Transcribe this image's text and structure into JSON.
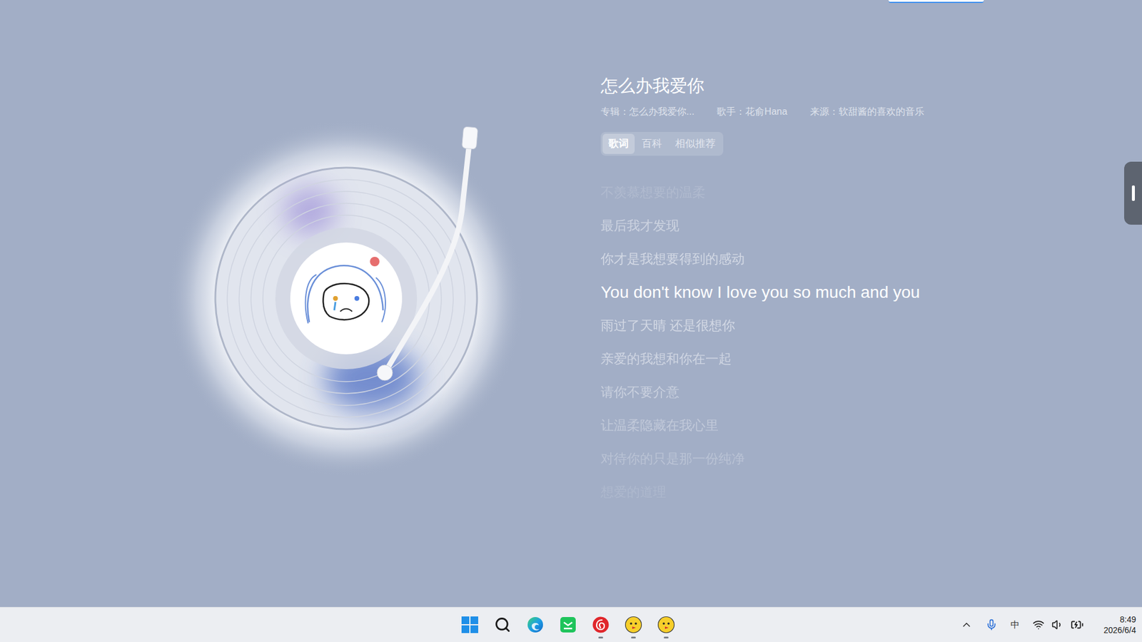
{
  "song": {
    "title": "怎么办我爱你",
    "meta": [
      "专辑：怎么办我爱你...",
      "歌手：花俞Hana",
      "来源：软甜酱的喜欢的音乐"
    ]
  },
  "tabs": [
    {
      "label": "歌词",
      "selected": true
    },
    {
      "label": "百科",
      "selected": false
    },
    {
      "label": "相似推荐",
      "selected": false
    }
  ],
  "lyrics": [
    {
      "text": "不羡慕想要的温柔",
      "current": false
    },
    {
      "text": "最后我才发现",
      "current": false
    },
    {
      "text": "你才是我想要得到的感动",
      "current": false
    },
    {
      "text": "You don't know I love you so much and you",
      "current": true
    },
    {
      "text": "雨过了天晴 还是很想你",
      "current": false
    },
    {
      "text": "亲爱的我想和你在一起",
      "current": false
    },
    {
      "text": "请你不要介意",
      "current": false
    },
    {
      "text": "让温柔隐藏在我心里",
      "current": false
    },
    {
      "text": "对待你的只是那一份纯净",
      "current": false
    },
    {
      "text": "想爱的道理",
      "current": false
    }
  ],
  "taskbar": {
    "apps": [
      {
        "name": "start",
        "running": false
      },
      {
        "name": "search",
        "running": false
      },
      {
        "name": "edge",
        "running": false
      },
      {
        "name": "green-app",
        "running": false
      },
      {
        "name": "netease-music",
        "running": true
      },
      {
        "name": "yellow-app",
        "running": true
      },
      {
        "name": "yellow-app",
        "running": true
      }
    ],
    "ime": "中",
    "time": "8:49",
    "date": "2026/6/4"
  }
}
